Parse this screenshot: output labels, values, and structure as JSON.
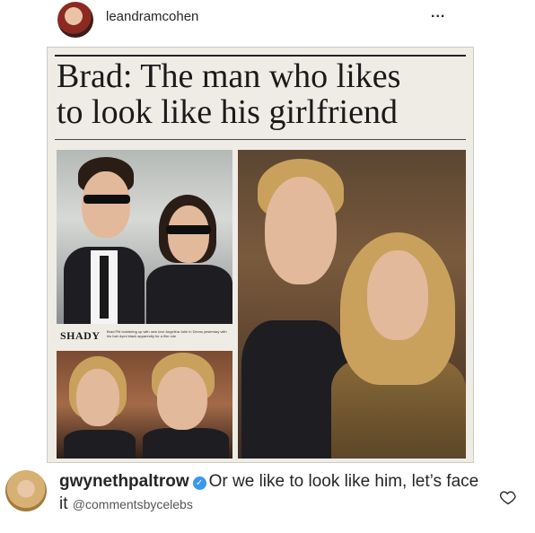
{
  "post": {
    "username": "leandramcohen",
    "more_label": "..."
  },
  "clipping": {
    "headline_line1": "Brad: The man who likes",
    "headline_line2": "to look like his girlfriend",
    "caption_title": "SHADY",
    "caption_text": "Brad Pitt bolstering up with new love Angelina Jolie in Devos yesterday with his hair dyed black apparently for a film role"
  },
  "comment": {
    "username": "gwynethpaltrow",
    "text": "Or we like to look like him, let’s face it",
    "credit": "@commentsbycelebs"
  },
  "colors": {
    "text": "#262626",
    "verified": "#3897f0",
    "paper": "#efece6"
  },
  "icons": [
    "more-icon",
    "verified-icon",
    "heart-icon"
  ]
}
